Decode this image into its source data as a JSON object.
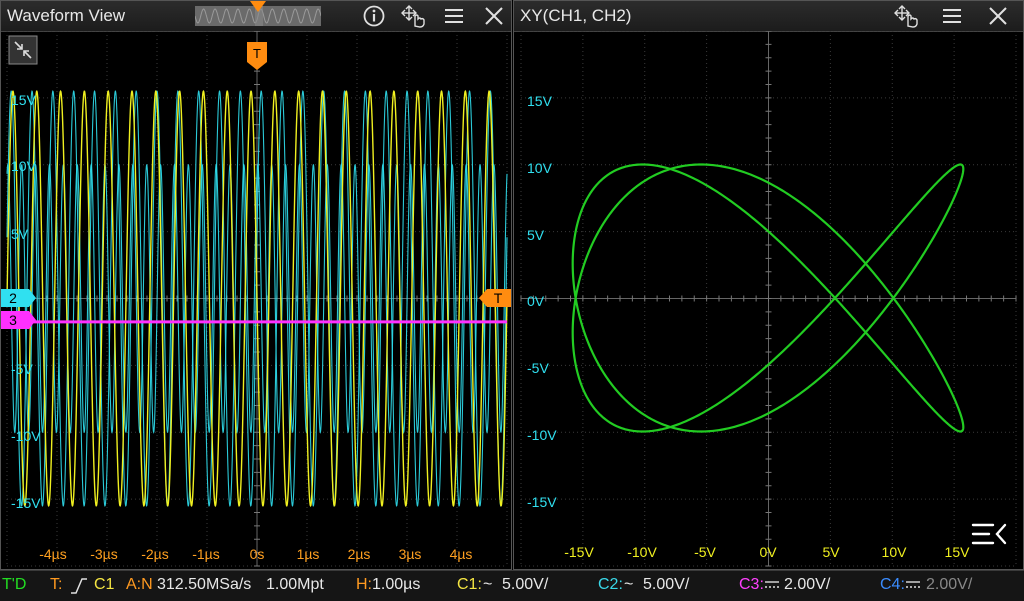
{
  "waveform": {
    "title": "Waveform View",
    "ch2_marker": "2",
    "ch3_marker": "3",
    "trigger_top": "T",
    "trigger_right": "T",
    "y_labels": [
      "15V",
      "10V",
      "5V",
      "-5V",
      "-10V",
      "-15V"
    ],
    "x_labels": [
      "-4µs",
      "-3µs",
      "-2µs",
      "-1µs",
      "0s",
      "1µs",
      "2µs",
      "3µs",
      "4µs"
    ]
  },
  "xy": {
    "title": "XY(CH1, CH2)",
    "y_labels": [
      "15V",
      "10V",
      "5V",
      "0V",
      "-5V",
      "-10V",
      "-15V"
    ],
    "x_labels": [
      "-15V",
      "-10V",
      "-5V",
      "0V",
      "5V",
      "10V",
      "15V"
    ]
  },
  "status": {
    "mode": "T'D",
    "trigger_label": "T:",
    "trigger_source": "C1",
    "acq": "A:N",
    "sample_rate": "312.50MSa/s",
    "memory": "1.00Mpt",
    "h_label": "H:",
    "h_value": "1.00µs",
    "c1_label": "C1:",
    "c1_value": "5.00V/",
    "c2_label": "C2:",
    "c2_value": "5.00V/",
    "c3_label": "C3:",
    "c3_value": "2.00V/",
    "c4_label": "C4:",
    "c4_value": "2.00V/"
  },
  "colors": {
    "ch1": "#f0f020",
    "ch2": "#30e0f0",
    "ch3": "#ff30ff",
    "ch4": "#2878ff",
    "trigger": "#ff8c10",
    "xy_trace": "#22cc22",
    "ch1_label": "#f5e642",
    "ch2_label": "#3ad8e8",
    "ch3_label": "#ff40ff",
    "ch4_label": "#3a8cff"
  }
}
